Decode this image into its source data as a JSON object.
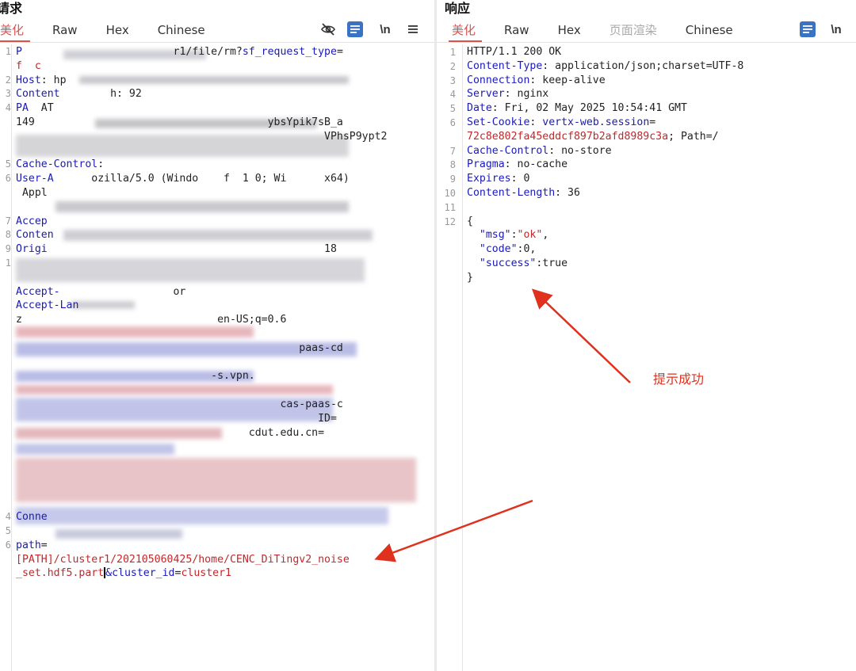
{
  "request": {
    "title": "请求",
    "tabs": [
      "美化",
      "Raw",
      "Hex",
      "Chinese"
    ],
    "toolbar": {
      "hide_icon": "eye-off-icon",
      "format_icon": "list-icon",
      "newline_label": "\\n",
      "menu_icon": "hamburger-icon"
    },
    "lines": [
      {
        "parts": [
          [
            "k",
            "P"
          ],
          [
            "v",
            "                        r1/file/rm?"
          ],
          [
            "k",
            "sf_request_type"
          ],
          [
            "v",
            "="
          ]
        ]
      },
      {
        "parts": [
          [
            "r",
            "f  c"
          ]
        ]
      },
      {
        "parts": [
          [
            "k",
            "H"
          ],
          [
            "k",
            "ost"
          ],
          [
            "v",
            ": hp"
          ]
        ]
      },
      {
        "parts": [
          [
            "k",
            "Co"
          ],
          [
            "k",
            "ntent"
          ],
          [
            "v",
            "        h: 92"
          ]
        ]
      },
      {
        "parts": [
          [
            "k",
            "PA"
          ],
          [
            "v",
            "  AT"
          ]
        ]
      },
      {
        "parts": [
          [
            "v",
            "149"
          ],
          [
            "v",
            "                                     "
          ],
          [
            "v",
            "ybsYpik7sB_a"
          ]
        ]
      },
      {
        "parts": [
          [
            "v",
            "                                                 "
          ],
          [
            "v",
            "VPhsP9ypt2"
          ]
        ]
      },
      {
        "parts": [
          [
            "v",
            ""
          ]
        ]
      },
      {
        "parts": [
          [
            "k",
            "Cache-"
          ],
          [
            "k",
            "Control"
          ],
          [
            "v",
            ":"
          ]
        ]
      },
      {
        "parts": [
          [
            "k",
            "User-A"
          ],
          [
            "v",
            "      ozilla/5.0 (Windo    f  1 0; Wi      x64)"
          ]
        ]
      },
      {
        "parts": [
          [
            "v",
            " Appl"
          ]
        ]
      },
      {
        "parts": [
          [
            "v",
            ""
          ]
        ]
      },
      {
        "parts": [
          [
            "k",
            "Accep"
          ]
        ]
      },
      {
        "parts": [
          [
            "k",
            "Conten"
          ]
        ]
      },
      {
        "parts": [
          [
            "k",
            "Origi"
          ],
          [
            "v",
            "                                            18"
          ]
        ]
      },
      {
        "parts": [
          [
            "v",
            ""
          ]
        ]
      },
      {
        "parts": [
          [
            "v",
            ""
          ]
        ]
      },
      {
        "parts": [
          [
            "k",
            "Accept-"
          ],
          [
            "v",
            "                  or"
          ]
        ]
      },
      {
        "parts": [
          [
            "k",
            "Accept-Lan"
          ]
        ]
      },
      {
        "parts": [
          [
            "v",
            "z                               en-US;q=0.6"
          ]
        ]
      },
      {
        "parts": [
          [
            "v",
            ""
          ]
        ]
      },
      {
        "parts": [
          [
            "v",
            "                                             paas-cd"
          ]
        ]
      },
      {
        "parts": [
          [
            "v",
            ""
          ]
        ]
      },
      {
        "parts": [
          [
            "v",
            "                               -s.vpn."
          ]
        ]
      },
      {
        "parts": [
          [
            "v",
            ""
          ]
        ]
      },
      {
        "parts": [
          [
            "v",
            "                                          cas-paas-c"
          ]
        ]
      },
      {
        "parts": [
          [
            "v",
            "                                                ID="
          ]
        ]
      },
      {
        "parts": [
          [
            "v",
            "                                     cdut.edu.cn="
          ]
        ]
      },
      {
        "parts": [
          [
            "v",
            ""
          ]
        ]
      },
      {
        "parts": [
          [
            "v",
            ""
          ]
        ]
      },
      {
        "parts": [
          [
            "v",
            ""
          ]
        ]
      },
      {
        "parts": [
          [
            "v",
            ""
          ]
        ]
      },
      {
        "parts": [
          [
            "v",
            ""
          ]
        ]
      },
      {
        "parts": [
          [
            "k",
            "Conne"
          ]
        ]
      },
      {
        "parts": [
          [
            "v",
            ""
          ]
        ]
      },
      {
        "parts": [
          [
            "k",
            "path"
          ],
          [
            "v",
            "="
          ]
        ]
      },
      {
        "parts": [
          [
            "r",
            "[PATH]/cluster1/202105060425/home/CENC_DiTingv2_noise"
          ]
        ]
      },
      {
        "parts": [
          [
            "r",
            "_set.hdf5.part"
          ],
          [
            "cursor",
            ""
          ],
          [
            "k",
            "&cluster_id"
          ],
          [
            "v",
            "="
          ],
          [
            "r",
            "cluster1"
          ]
        ]
      }
    ],
    "line_numbers": [
      "1",
      "",
      "2",
      "3",
      "4",
      "",
      "",
      "",
      "5",
      "6",
      "",
      "",
      "7",
      "8",
      "9",
      "1",
      "",
      "",
      "",
      "",
      "",
      "",
      "",
      "",
      "",
      "",
      "",
      "",
      "",
      "",
      "",
      "",
      "",
      "4",
      "5",
      "6",
      "",
      ""
    ]
  },
  "response": {
    "title": "响应",
    "tabs": [
      "美化",
      "Raw",
      "Hex",
      "页面渲染",
      "Chinese"
    ],
    "toolbar": {
      "format_icon": "list-icon",
      "newline_label": "\\n"
    },
    "lines": [
      {
        "n": "1",
        "parts": [
          [
            "v",
            "HTTP/1.1 200 OK"
          ]
        ]
      },
      {
        "n": "2",
        "parts": [
          [
            "k",
            "Content-Type"
          ],
          [
            "v",
            ": application/json;charset=UTF-8"
          ]
        ]
      },
      {
        "n": "3",
        "parts": [
          [
            "k",
            "Connection"
          ],
          [
            "v",
            ": keep-alive"
          ]
        ]
      },
      {
        "n": "4",
        "parts": [
          [
            "k",
            "Server"
          ],
          [
            "v",
            ": nginx"
          ]
        ]
      },
      {
        "n": "5",
        "parts": [
          [
            "k",
            "Date"
          ],
          [
            "v",
            ": Fri, 02 May 2025 10:54:41 GMT"
          ]
        ]
      },
      {
        "n": "6",
        "parts": [
          [
            "k",
            "Set-Cookie"
          ],
          [
            "v",
            ": "
          ],
          [
            "k",
            "vertx-web.session"
          ],
          [
            "v",
            "="
          ]
        ]
      },
      {
        "n": "",
        "parts": [
          [
            "r",
            "72c8e802fa45eddcf897b2afd8989c3a"
          ],
          [
            "v",
            "; Path=/"
          ]
        ]
      },
      {
        "n": "7",
        "parts": [
          [
            "k",
            "Cache-Control"
          ],
          [
            "v",
            ": no-store"
          ]
        ]
      },
      {
        "n": "8",
        "parts": [
          [
            "k",
            "Pragma"
          ],
          [
            "v",
            ": no-cache"
          ]
        ]
      },
      {
        "n": "9",
        "parts": [
          [
            "k",
            "Expires"
          ],
          [
            "v",
            ": 0"
          ]
        ]
      },
      {
        "n": "10",
        "parts": [
          [
            "k",
            "Content-Length"
          ],
          [
            "v",
            ": 36"
          ]
        ]
      },
      {
        "n": "11",
        "parts": [
          [
            "v",
            ""
          ]
        ]
      },
      {
        "n": "12",
        "parts": [
          [
            "v",
            "{"
          ]
        ]
      },
      {
        "n": "",
        "parts": [
          [
            "v",
            "  "
          ],
          [
            "k",
            "\"msg\""
          ],
          [
            "v",
            ":"
          ],
          [
            "r",
            "\"ok\""
          ],
          [
            "v",
            ","
          ]
        ]
      },
      {
        "n": "",
        "parts": [
          [
            "v",
            "  "
          ],
          [
            "k",
            "\"code\""
          ],
          [
            "v",
            ":0,"
          ]
        ]
      },
      {
        "n": "",
        "parts": [
          [
            "v",
            "  "
          ],
          [
            "k",
            "\"success\""
          ],
          [
            "v",
            ":true"
          ]
        ]
      },
      {
        "n": "",
        "parts": [
          [
            "v",
            "}"
          ]
        ]
      }
    ]
  },
  "annotations": {
    "success_label": "提示成功",
    "arrow_color": "#e0301e"
  }
}
